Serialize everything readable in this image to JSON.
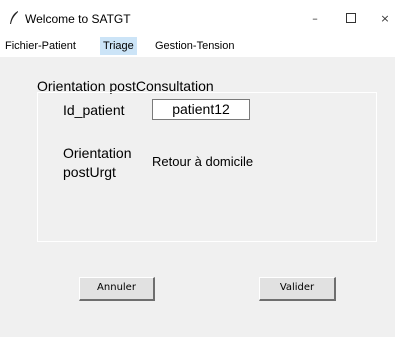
{
  "window": {
    "title": "Welcome to SATGT",
    "minimize_glyph": "–",
    "close_glyph": "×"
  },
  "menu": {
    "items": [
      {
        "label": "Fichier-Patient",
        "active": false
      },
      {
        "label": "Triage",
        "active": true
      },
      {
        "label": "Gestion-Tension",
        "active": false
      }
    ]
  },
  "form": {
    "frame_title": "Orientation postConsultation",
    "id_label": "Id_patient",
    "id_value": "patient12",
    "orientation_label": "Orientation postUrgt",
    "orientation_value": "Retour à domicile"
  },
  "buttons": {
    "cancel_label": "Annuler",
    "submit_label": "Valider"
  },
  "colors": {
    "active_menu_bg": "#cce4f7",
    "content_bg": "#f0f0f0",
    "button_bg": "#e1e1e1"
  }
}
